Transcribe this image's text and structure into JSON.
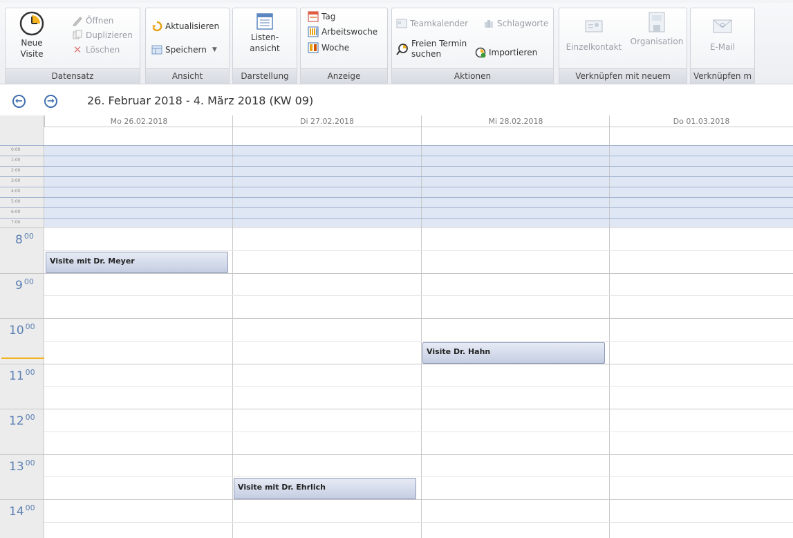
{
  "ribbon": {
    "datensatz": {
      "label": "Datensatz",
      "neue_visite": "Neue\nVisite",
      "oeffnen": "Öffnen",
      "duplizieren": "Duplizieren",
      "loeschen": "Löschen"
    },
    "ansicht": {
      "label": "Ansicht",
      "aktualisieren": "Aktualisieren",
      "speichern": "Speichern"
    },
    "darstellung": {
      "label": "Darstellung",
      "listenansicht_1": "Listen-",
      "listenansicht_2": "ansicht"
    },
    "anzeige": {
      "label": "Anzeige",
      "tag": "Tag",
      "arbeitswoche": "Arbeitswoche",
      "woche": "Woche"
    },
    "aktionen": {
      "label": "Aktionen",
      "teamkalender": "Teamkalender",
      "schlagworte": "Schlagworte",
      "freien_termin_1": "Freien Termin",
      "freien_termin_2": "suchen",
      "importieren": "Importieren"
    },
    "verknuepfen_neu": {
      "label": "Verknüpfen mit neuem",
      "einzelkontakt": "Einzelkontakt",
      "organisation": "Organisation"
    },
    "verknuepfen_m": {
      "label": "Verknüpfen m",
      "email": "E-Mail"
    }
  },
  "nav": {
    "range": "26. Februar 2018 - 4. März 2018 (KW 09)",
    "prev_icon": "arrow-left-icon",
    "next_icon": "arrow-right-icon"
  },
  "days": [
    "Mo 26.02.2018",
    "Di 27.02.2018",
    "Mi 28.02.2018",
    "Do 01.03.2018"
  ],
  "night_hours": [
    "0:00",
    "1:00",
    "2:00",
    "3:00",
    "4:00",
    "5:00",
    "6:00",
    "7:00"
  ],
  "hours": [
    "8",
    "9",
    "10",
    "11",
    "12",
    "13",
    "14"
  ],
  "hour_suffix": "00",
  "events": [
    {
      "title": "Visite mit Dr. Meyer",
      "day": "Mo 26.02.2018",
      "start": "8:30",
      "end": "9:00"
    },
    {
      "title": "Visite Dr. Hahn",
      "day": "Mi 28.02.2018",
      "start": "10:30",
      "end": "11:00"
    },
    {
      "title": "Visite mit Dr. Ehrlich",
      "day": "Di 27.02.2018",
      "start": "13:30",
      "end": "14:00"
    }
  ],
  "colors": {
    "accent": "#3f6fb0",
    "event_fill": "#c4cde2",
    "night_zone": "#dfe7f5",
    "now_marker": "#f2b320"
  }
}
